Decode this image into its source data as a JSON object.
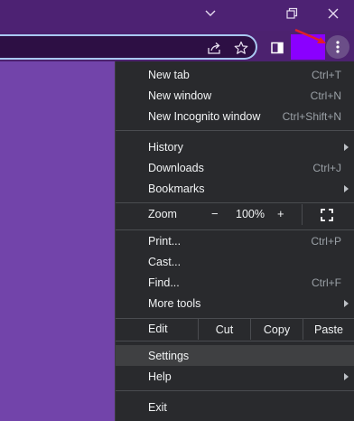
{
  "window_controls": {
    "chevron_icon": "chevron-down-icon",
    "restore_icon": "restore-icon",
    "close_icon": "close-icon"
  },
  "toolbar": {
    "share_icon": "share-icon",
    "bookmark_icon": "star-icon",
    "sidepanel_icon": "side-panel-icon",
    "menu_icon": "kebab-menu-icon"
  },
  "colors": {
    "page_purple": "#7343a8",
    "titlebar": "#4d2273",
    "menu_bg": "#292a2d",
    "highlight": "#3f4042",
    "annotation_arrow": "#e0202a",
    "profile_block": "#8a00ff"
  },
  "menu": {
    "new_tab": {
      "label": "New tab",
      "shortcut": "Ctrl+T"
    },
    "new_window": {
      "label": "New window",
      "shortcut": "Ctrl+N"
    },
    "new_incognito": {
      "label": "New Incognito window",
      "shortcut": "Ctrl+Shift+N"
    },
    "history": {
      "label": "History"
    },
    "downloads": {
      "label": "Downloads",
      "shortcut": "Ctrl+J"
    },
    "bookmarks": {
      "label": "Bookmarks"
    },
    "zoom": {
      "label": "Zoom",
      "minus": "−",
      "value": "100%",
      "plus": "+"
    },
    "print": {
      "label": "Print...",
      "shortcut": "Ctrl+P"
    },
    "cast": {
      "label": "Cast..."
    },
    "find": {
      "label": "Find...",
      "shortcut": "Ctrl+F"
    },
    "more_tools": {
      "label": "More tools"
    },
    "edit": {
      "label": "Edit",
      "cut": "Cut",
      "copy": "Copy",
      "paste": "Paste"
    },
    "settings": {
      "label": "Settings"
    },
    "help": {
      "label": "Help"
    },
    "exit": {
      "label": "Exit"
    }
  }
}
